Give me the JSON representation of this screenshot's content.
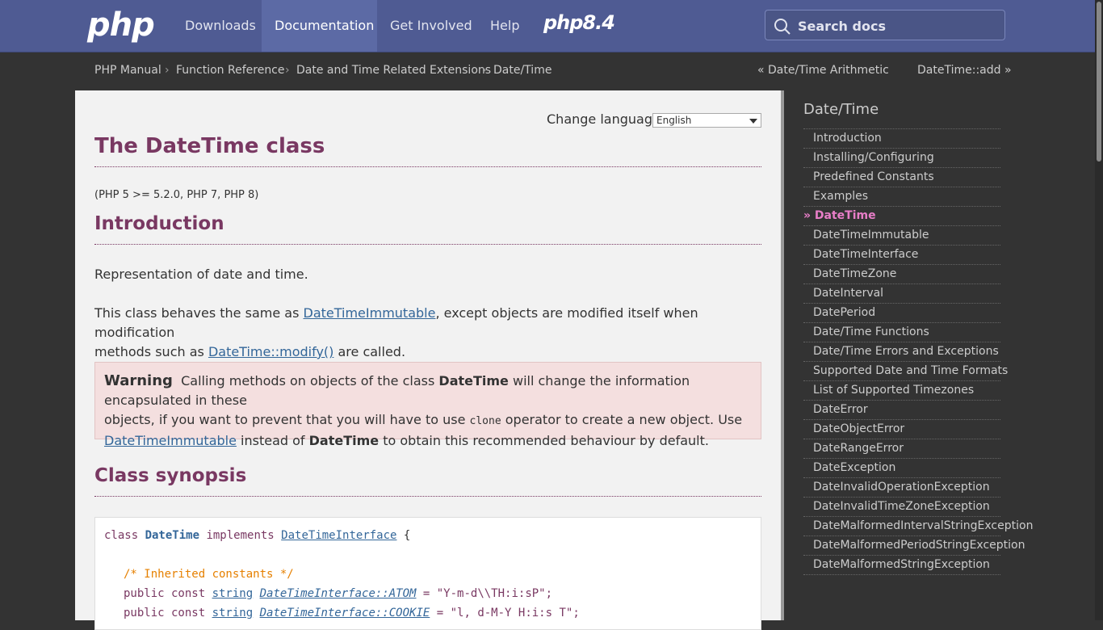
{
  "nav": {
    "logo": "php",
    "items": [
      "Downloads",
      "Documentation",
      "Get Involved",
      "Help"
    ],
    "active": "Documentation",
    "version_badge": "php8.4",
    "search_placeholder": "Search docs"
  },
  "breadcrumb": {
    "items": [
      "PHP Manual",
      "Function Reference",
      "Date and Time Related Extensions",
      "Date/Time"
    ],
    "separator": "›",
    "prev": "« Date/Time Arithmetic",
    "next": "DateTime::add »"
  },
  "main": {
    "change_language_label": "Change language:",
    "language_selected": "English",
    "title": "The DateTime class",
    "version": "(PHP 5 >= 5.2.0, PHP 7, PHP 8)",
    "intro_heading": "Introduction",
    "intro_p1": "Representation of date and time.",
    "intro_p2_a": "This class behaves the same as ",
    "intro_p2_link1": "DateTimeImmutable",
    "intro_p2_b": ", except objects are modified itself when modification",
    "intro_p2_c": "methods such as ",
    "intro_p2_link2": "DateTime::modify()",
    "intro_p2_d": " are called.",
    "warning": {
      "title": "Warning",
      "t1": "Calling methods on objects of the class ",
      "b1": "DateTime",
      "t2": " will change the information encapsulated in these",
      "t3": "objects, if you want to prevent that you will have to use ",
      "code": "clone",
      "t4": " operator to create a new object. Use",
      "link": "DateTimeImmutable",
      "t5": " instead of ",
      "b2": "DateTime",
      "t6": " to obtain this recommended behaviour by default."
    },
    "synopsis_heading": "Class synopsis",
    "code": {
      "l1_kw": "class ",
      "l1_cls": "DateTime",
      "l1_impl": " implements ",
      "l1_iface": "DateTimeInterface",
      "l1_brace": " {",
      "comment": "/* Inherited constants */",
      "pub_const": "public const ",
      "type": "string",
      "c1_name": "DateTimeInterface::ATOM",
      "c1_val": " = \"Y-m-d\\\\TH:i:sP\";",
      "c2_name": "DateTimeInterface::COOKIE",
      "c2_val": " = \"l, d-M-Y H:i:s T\";"
    }
  },
  "sidebar": {
    "title": "Date/Time",
    "current_marker": "»",
    "items": [
      "Introduction",
      "Installing/Configuring",
      "Predefined Constants",
      "Examples",
      "DateTime",
      "DateTimeImmutable",
      "DateTimeInterface",
      "DateTimeZone",
      "DateInterval",
      "DatePeriod",
      "Date/Time Functions",
      "Date/Time Errors and Exceptions",
      "Supported Date and Time Formats",
      "List of Supported Timezones",
      "DateError",
      "DateObjectError",
      "DateRangeError",
      "DateException",
      "DateInvalidOperationException",
      "DateInvalidTimeZoneException",
      "DateMalformedIntervalStringException",
      "DateMalformedPeriodStringException",
      "DateMalformedStringException"
    ],
    "current": "DateTime"
  },
  "colors": {
    "nav_bg": "#4f5b93",
    "heading": "#793862",
    "link": "#336699",
    "warning_bg": "#f4dfdf"
  }
}
